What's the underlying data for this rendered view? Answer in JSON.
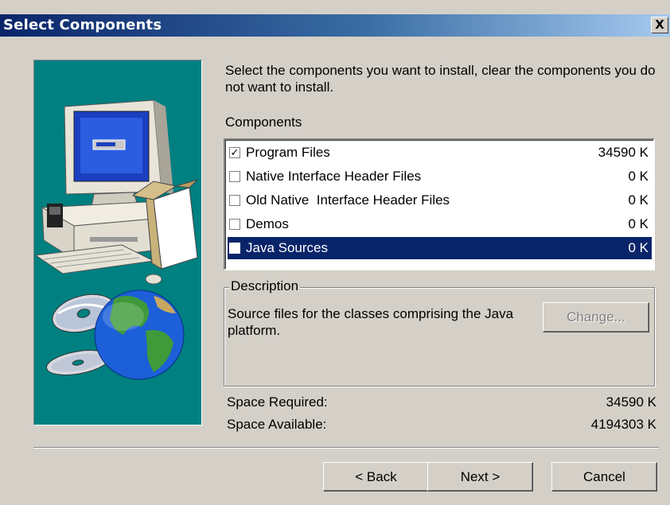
{
  "window": {
    "title": "Select Components",
    "close_glyph": "X"
  },
  "intro": {
    "instructions": "Select the components you want to install, clear the components you do not want to install.",
    "components_label": "Components"
  },
  "components": [
    {
      "name": "Program Files",
      "size": "34590 K",
      "checked": true,
      "selected": false
    },
    {
      "name": "Native Interface Header Files",
      "size": "0 K",
      "checked": false,
      "selected": false
    },
    {
      "name": "Old Native  Interface Header Files",
      "size": "0 K",
      "checked": false,
      "selected": false
    },
    {
      "name": "Demos",
      "size": "0 K",
      "checked": false,
      "selected": false
    },
    {
      "name": "Java Sources",
      "size": "0 K",
      "checked": false,
      "selected": true
    }
  ],
  "description": {
    "legend": "Description",
    "text": "Source files for the classes comprising the Java platform.",
    "change_label": "Change..."
  },
  "space": {
    "required_label": "Space Required:",
    "required_value": "34590 K",
    "available_label": "Space Available:",
    "available_value": "4194303 K"
  },
  "buttons": {
    "back": "< Back",
    "next": "Next >",
    "cancel": "Cancel"
  },
  "colors": {
    "title_bar": "#0a246a",
    "selection": "#0a246a",
    "image_background": "#008080",
    "dialog_face": "#d4d0c8"
  },
  "icons": [
    "computer-icon",
    "software-box-icon",
    "cd-disc-icon",
    "globe-icon",
    "checkmark-icon"
  ]
}
